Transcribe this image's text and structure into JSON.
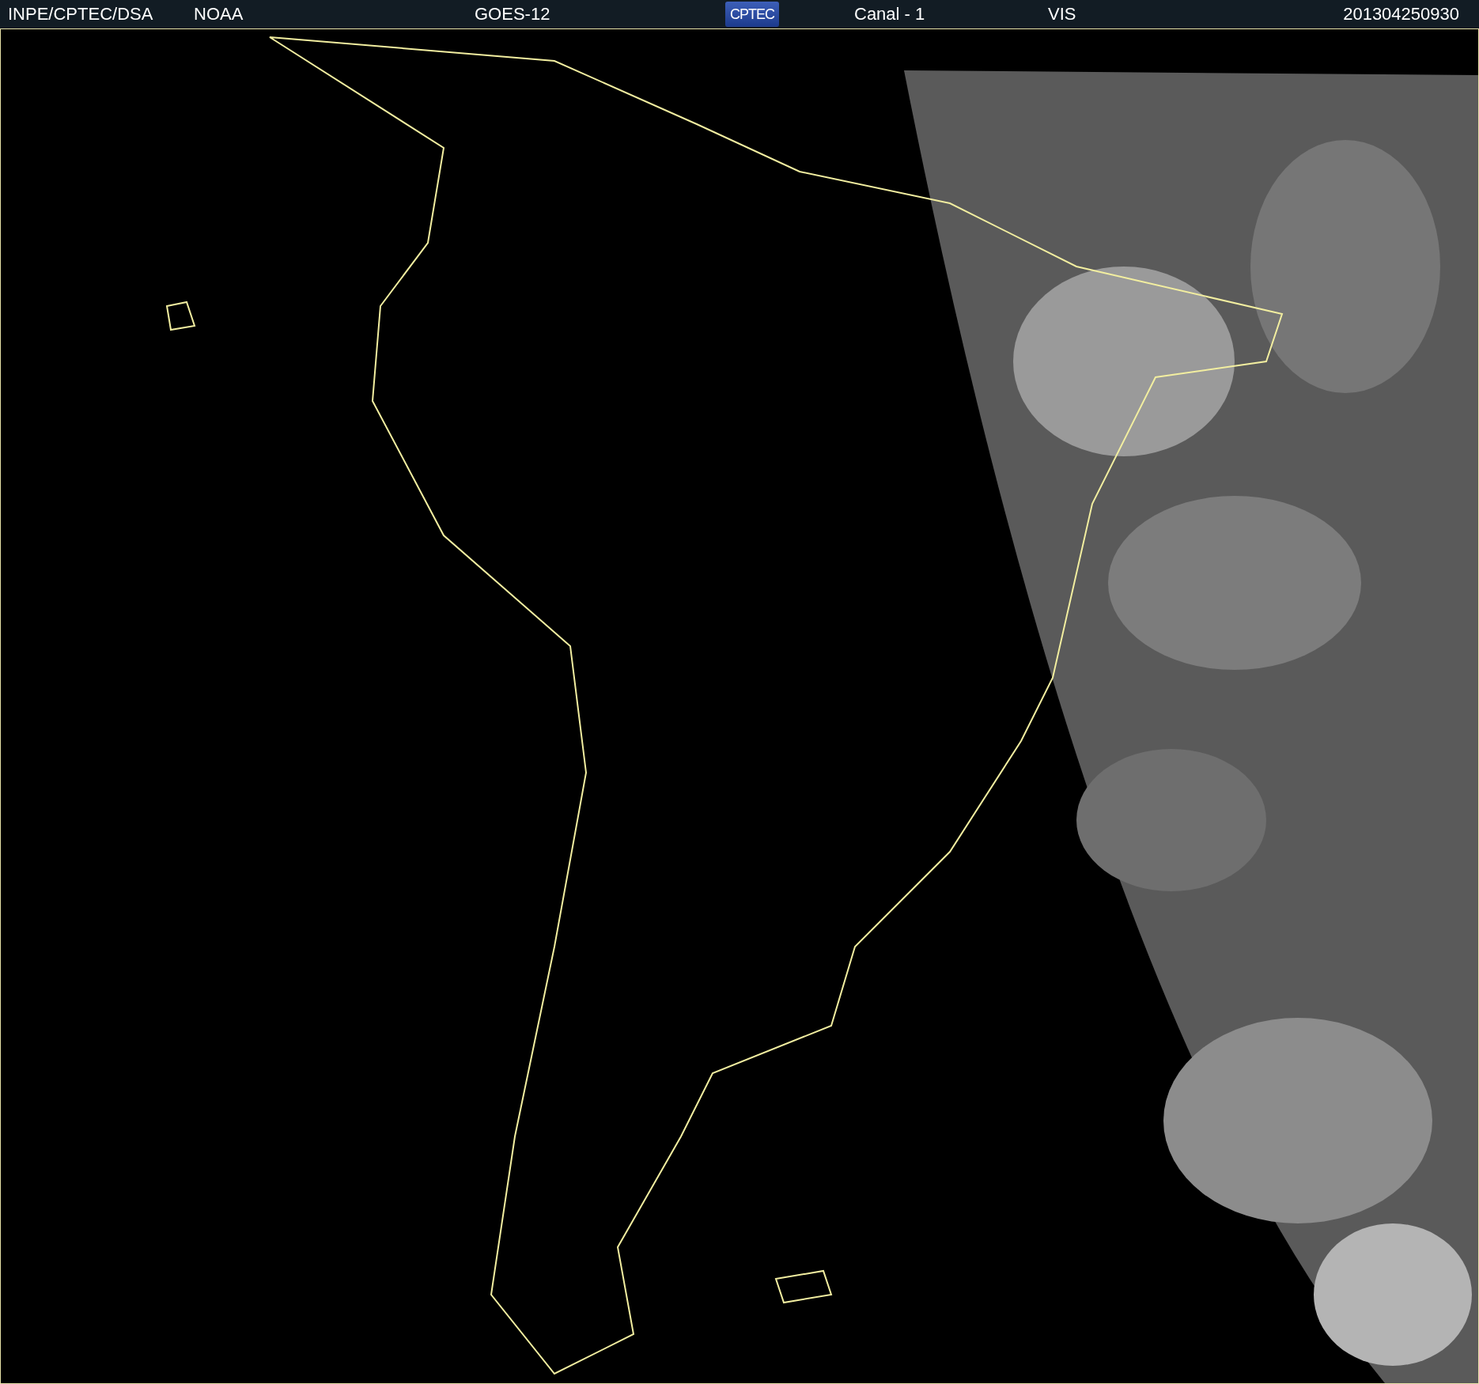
{
  "header": {
    "items": [
      {
        "kind": "text",
        "text": "INPE/CPTEC/DSA"
      },
      {
        "kind": "text",
        "text": "NOAA"
      },
      {
        "kind": "text",
        "text": "GOES-12"
      },
      {
        "kind": "logo",
        "text": "CPTEC"
      },
      {
        "kind": "text",
        "text": "Canal - 1"
      },
      {
        "kind": "text",
        "text": "VIS"
      },
      {
        "kind": "text",
        "text": "201304250930"
      }
    ]
  }
}
